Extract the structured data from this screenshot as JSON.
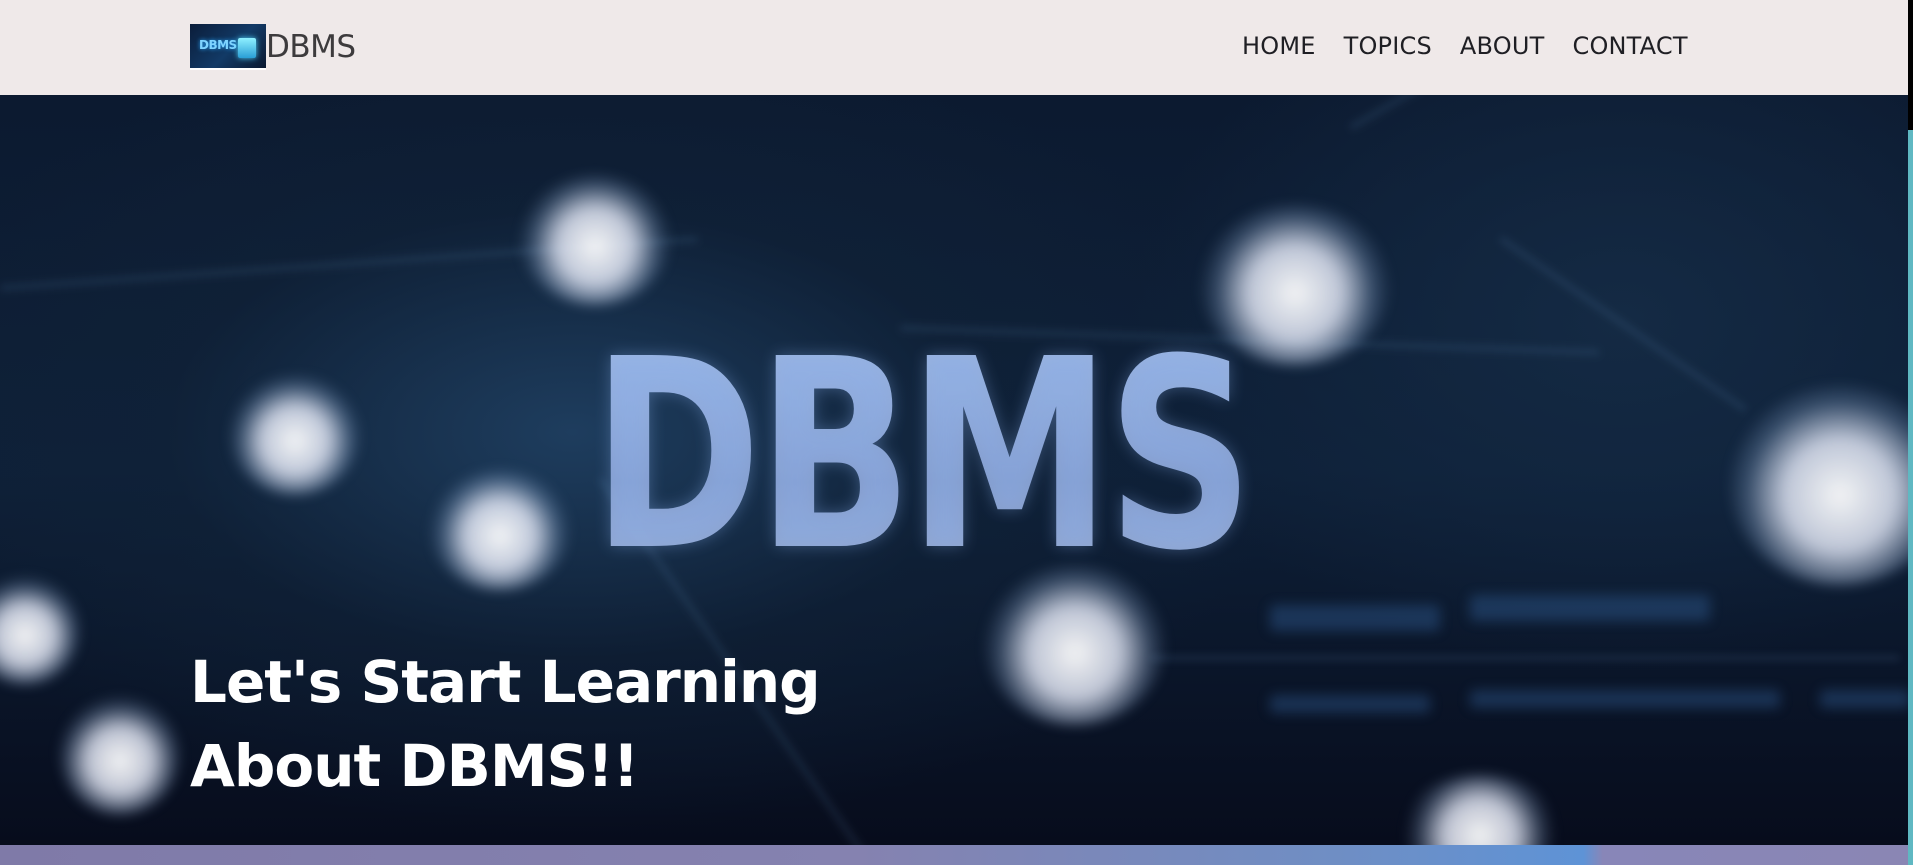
{
  "navbar": {
    "brand_name": "DBMS",
    "logo_text": "DBMS",
    "links": [
      {
        "label": "HOME"
      },
      {
        "label": "TOPICS"
      },
      {
        "label": "ABOUT"
      },
      {
        "label": "CONTACT"
      }
    ]
  },
  "hero": {
    "background_title": "DBMS",
    "heading_line1": "Let's Start Learning",
    "heading_line2": "About DBMS!!"
  },
  "colors": {
    "navbar_bg": "#efe9e9",
    "hero_bg": "#0c1a30",
    "hero_text": "#ffffff",
    "strip": "#8582b0"
  },
  "icons": {
    "logo": "dbms-logo-image"
  }
}
